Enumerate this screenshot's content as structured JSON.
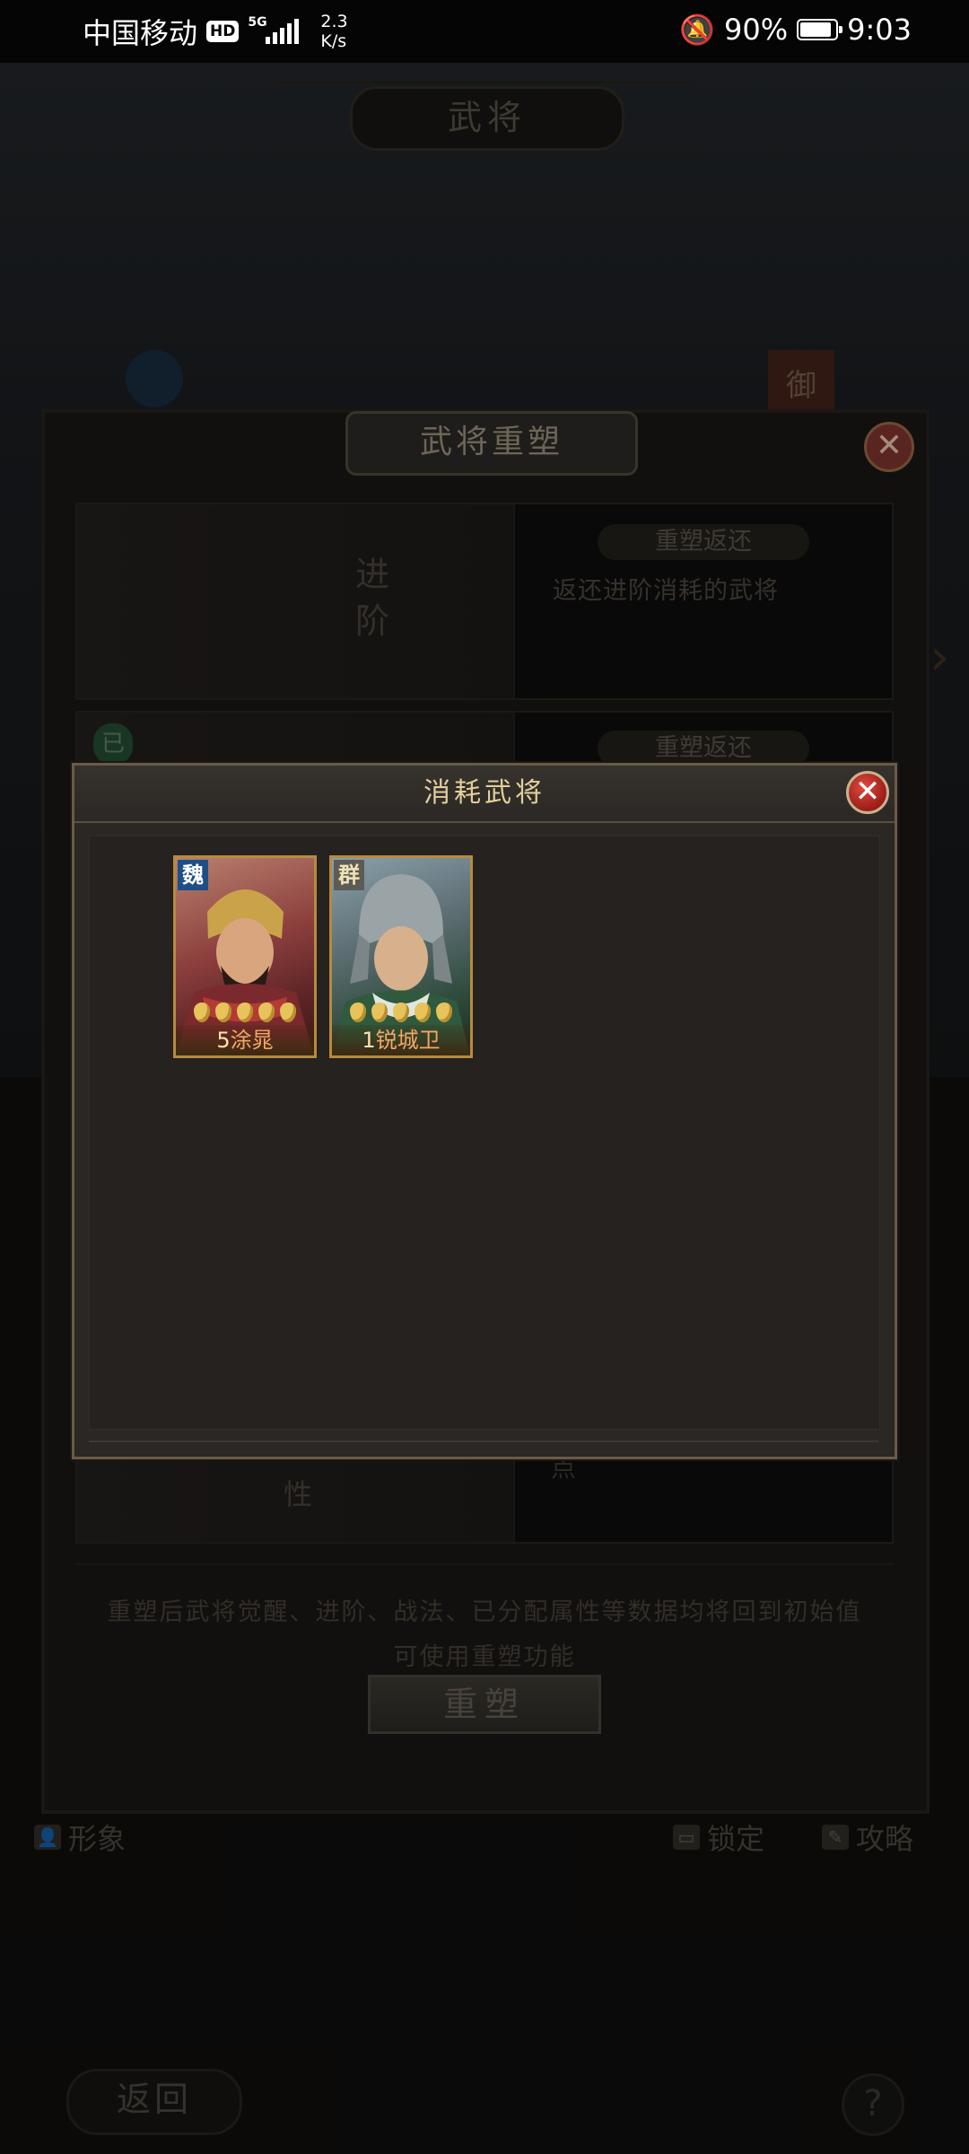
{
  "status_bar": {
    "carrier": "中国移动",
    "hd": "HD",
    "network": "5G",
    "speed_value": "2.3",
    "speed_unit": "K/s",
    "battery": "90%",
    "battery_level": 0.9,
    "time": "9:03"
  },
  "page": {
    "title": "武将"
  },
  "rebuild_dialog": {
    "title": "武将重塑",
    "close_icon": "close-icon",
    "advance_label": "进阶",
    "rebuild_return_label": "重塑返还",
    "advance_return_desc": "返还进阶消耗的武将",
    "second_return_label": "重塑返还",
    "activated_tag": "已",
    "attr_label_partial": "性",
    "points_label_partial": "点",
    "notice_line1": "重塑后武将觉醒、进阶、战法、已分配属性等数据均将回到初始值",
    "notice_line2": "可使用重塑功能",
    "rebuild_button": "重塑"
  },
  "bottom_actions": {
    "appearance": "形象",
    "lock": "锁定",
    "guide": "攻略",
    "back": "返回",
    "help": "?"
  },
  "consume_modal": {
    "title": "消耗武将",
    "generals": [
      {
        "faction": "魏",
        "level": "5",
        "name": "涂晁",
        "stars": 5,
        "faction_color": "#1e4f86"
      },
      {
        "faction": "群",
        "level": "1",
        "name": "锐城卫",
        "stars": 5,
        "faction_color": "#5d5b55"
      }
    ]
  },
  "colors": {
    "accent_gold": "#e3cf9b",
    "close_red": "#c22b24",
    "card_border": "#b78a3e"
  }
}
